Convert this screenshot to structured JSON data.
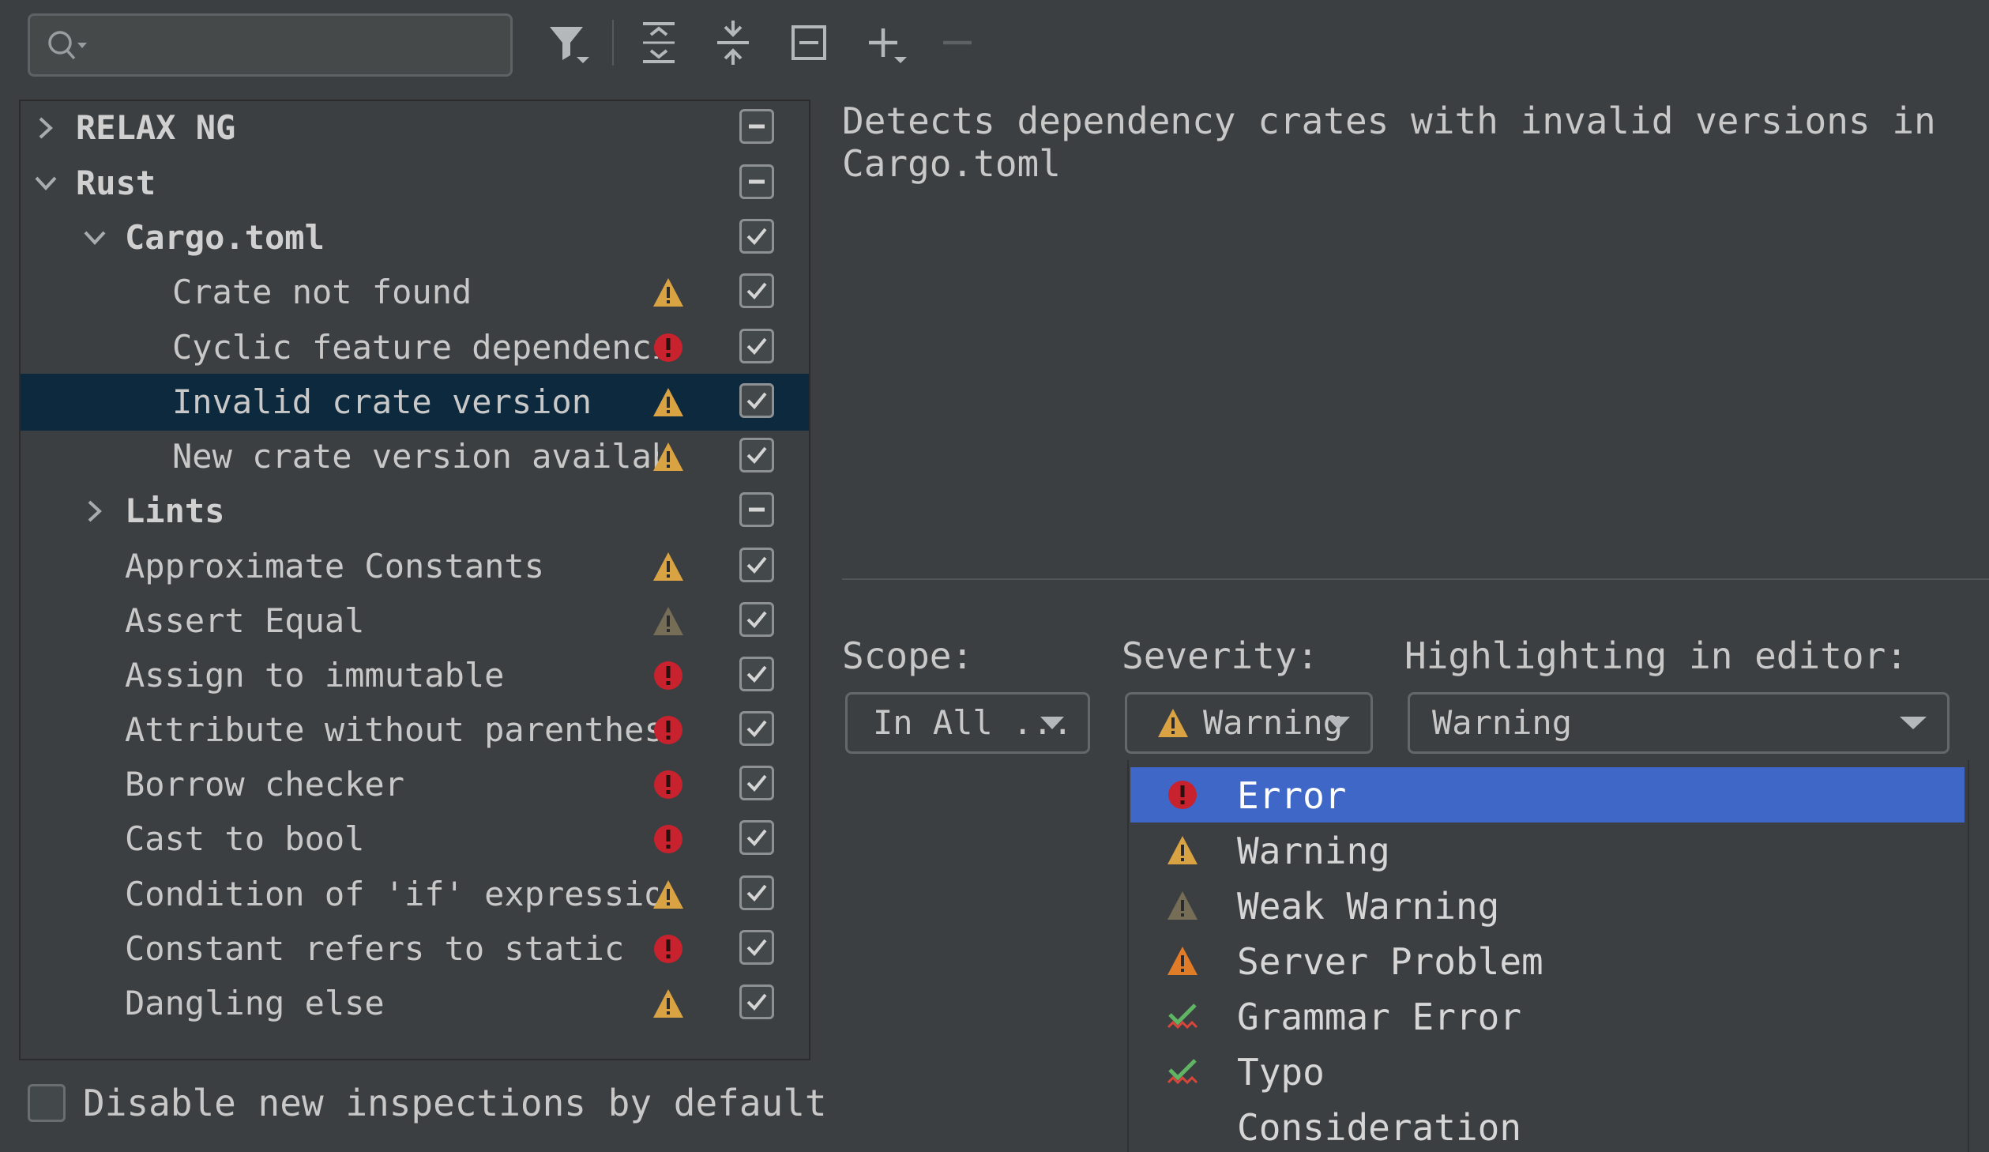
{
  "toolbar": {
    "search": {
      "value": "",
      "placeholder": ""
    },
    "buttons": [
      "filter-icon",
      "expand-all-icon",
      "collapse-all-icon",
      "reset-icon",
      "add-icon",
      "remove-icon"
    ]
  },
  "tree": {
    "rows": [
      {
        "label": "RELAX NG",
        "level": 0,
        "arrow": "right",
        "bold": true,
        "severity": "none",
        "check": "partial",
        "selected": false
      },
      {
        "label": "Rust",
        "level": 0,
        "arrow": "down",
        "bold": true,
        "severity": "none",
        "check": "partial",
        "selected": false
      },
      {
        "label": "Cargo.toml",
        "level": 1,
        "arrow": "down",
        "bold": true,
        "severity": "none",
        "check": "checked",
        "selected": false
      },
      {
        "label": "Crate not found",
        "level": 2,
        "arrow": "none",
        "bold": false,
        "severity": "warning",
        "check": "checked",
        "selected": false
      },
      {
        "label": "Cyclic feature dependencies",
        "level": 2,
        "arrow": "none",
        "bold": false,
        "severity": "error",
        "check": "checked",
        "selected": false
      },
      {
        "label": "Invalid crate version",
        "level": 2,
        "arrow": "none",
        "bold": false,
        "severity": "warning",
        "check": "checked",
        "selected": true
      },
      {
        "label": "New crate version available",
        "level": 2,
        "arrow": "none",
        "bold": false,
        "severity": "warning",
        "check": "checked",
        "selected": false
      },
      {
        "label": "Lints",
        "level": 1,
        "arrow": "right",
        "bold": true,
        "severity": "none",
        "check": "partial",
        "selected": false
      },
      {
        "label": "Approximate Constants",
        "level": 1,
        "arrow": "none",
        "bold": false,
        "severity": "warning",
        "check": "checked",
        "selected": false
      },
      {
        "label": "Assert Equal",
        "level": 1,
        "arrow": "none",
        "bold": false,
        "severity": "weak",
        "check": "checked",
        "selected": false
      },
      {
        "label": "Assign to immutable",
        "level": 1,
        "arrow": "none",
        "bold": false,
        "severity": "error",
        "check": "checked",
        "selected": false
      },
      {
        "label": "Attribute without parentheses",
        "level": 1,
        "arrow": "none",
        "bold": false,
        "severity": "error",
        "check": "checked",
        "selected": false
      },
      {
        "label": "Borrow checker",
        "level": 1,
        "arrow": "none",
        "bold": false,
        "severity": "error",
        "check": "checked",
        "selected": false
      },
      {
        "label": "Cast to bool",
        "level": 1,
        "arrow": "none",
        "bold": false,
        "severity": "error",
        "check": "checked",
        "selected": false
      },
      {
        "label": "Condition of 'if' expression",
        "level": 1,
        "arrow": "none",
        "bold": false,
        "severity": "warning",
        "check": "checked",
        "selected": false
      },
      {
        "label": "Constant refers to static",
        "level": 1,
        "arrow": "none",
        "bold": false,
        "severity": "error",
        "check": "checked",
        "selected": false
      },
      {
        "label": "Dangling else",
        "level": 1,
        "arrow": "none",
        "bold": false,
        "severity": "warning",
        "check": "checked",
        "selected": false
      }
    ]
  },
  "bottom": {
    "disable_new_label": "Disable new inspections by default"
  },
  "details": {
    "description": "Detects dependency crates with invalid versions in\nCargo.toml",
    "scope_label": "Scope:",
    "scope_value": "In All ...",
    "severity_label": "Severity:",
    "severity_value": "Warning",
    "highlighting_label": "Highlighting in editor:",
    "highlighting_value": "Warning"
  },
  "severity_dropdown": {
    "options": [
      {
        "label": "Error",
        "icon": "error",
        "selected": true
      },
      {
        "label": "Warning",
        "icon": "warning",
        "selected": false
      },
      {
        "label": "Weak Warning",
        "icon": "weak",
        "selected": false
      },
      {
        "label": "Server Problem",
        "icon": "server",
        "selected": false
      },
      {
        "label": "Grammar Error",
        "icon": "grammar",
        "selected": false
      },
      {
        "label": "Typo",
        "icon": "typo",
        "selected": false
      },
      {
        "label": "Consideration",
        "icon": "none",
        "selected": false
      }
    ]
  },
  "colors": {
    "warning": "#d9a343",
    "weak_warning": "#756d56",
    "server_problem": "#e07b27",
    "error": "#c7222d",
    "grammar_check": "#5fb564",
    "selection_tree": "#0d293e",
    "selection_list": "#3f67c8"
  }
}
